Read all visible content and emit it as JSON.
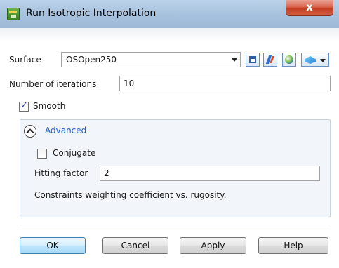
{
  "window": {
    "title": "Run Isotropic Interpolation",
    "close_label": "x"
  },
  "surface": {
    "label": "Surface",
    "value": "OSOpen250"
  },
  "iterations": {
    "label": "Number of iterations",
    "value": "10"
  },
  "smooth": {
    "label": "Smooth",
    "checked": true
  },
  "advanced": {
    "title": "Advanced",
    "conjugate": {
      "label": "Conjugate",
      "checked": false
    },
    "fitting_factor": {
      "label": "Fitting factor",
      "value": "2"
    },
    "note": "Constraints weighting coefficient vs. rugosity."
  },
  "buttons": {
    "ok": "OK",
    "cancel": "Cancel",
    "apply": "Apply",
    "help": "Help"
  },
  "colors": {
    "link": "#1f5fbf",
    "titlebar": "#a9c4df",
    "close": "#c43d22"
  }
}
